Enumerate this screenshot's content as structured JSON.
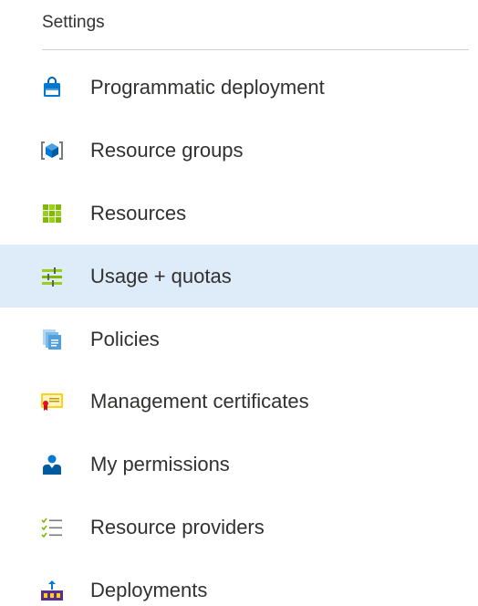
{
  "section": {
    "title": "Settings"
  },
  "menu": {
    "items": [
      {
        "label": "Programmatic deployment",
        "icon": "shopping-bag-icon",
        "selected": false
      },
      {
        "label": "Resource groups",
        "icon": "resource-group-cube-icon",
        "selected": false
      },
      {
        "label": "Resources",
        "icon": "grid-icon",
        "selected": false
      },
      {
        "label": "Usage + quotas",
        "icon": "usage-quotas-icon",
        "selected": true
      },
      {
        "label": "Policies",
        "icon": "policy-documents-icon",
        "selected": false
      },
      {
        "label": "Management certificates",
        "icon": "certificate-icon",
        "selected": false
      },
      {
        "label": "My permissions",
        "icon": "user-permissions-icon",
        "selected": false
      },
      {
        "label": "Resource providers",
        "icon": "checklist-icon",
        "selected": false
      },
      {
        "label": "Deployments",
        "icon": "deployment-upload-icon",
        "selected": false
      }
    ]
  },
  "colors": {
    "selected_background": "#deecf9",
    "text": "#323130",
    "accent_blue": "#0078d4"
  }
}
